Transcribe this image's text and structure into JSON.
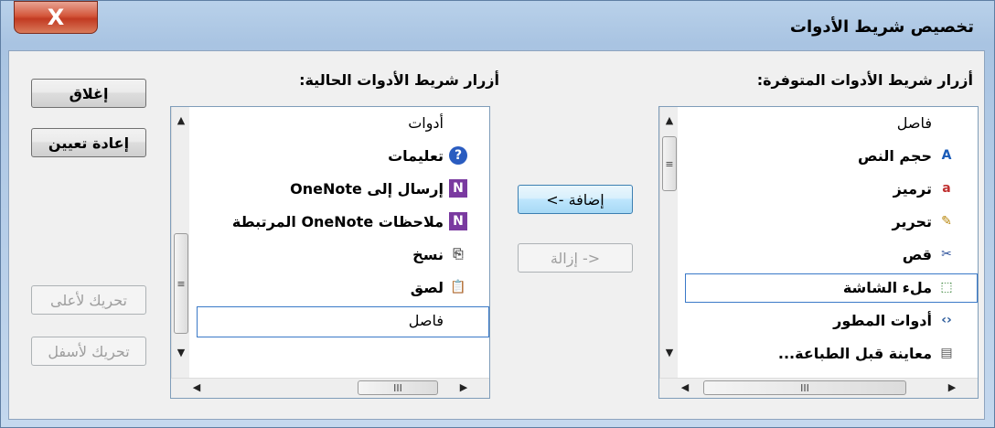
{
  "window": {
    "title": "تخصيص شريط الأدوات",
    "close_label": "X"
  },
  "available": {
    "label": "أزرار شريط الأدوات المتوفرة:",
    "items": [
      {
        "label": "فاصل",
        "icon": "none"
      },
      {
        "label": "حجم النص",
        "icon": "text-size-icon"
      },
      {
        "label": "ترميز",
        "icon": "encoding-icon"
      },
      {
        "label": "تحرير",
        "icon": "pencil-icon"
      },
      {
        "label": "قص",
        "icon": "scissors-icon"
      },
      {
        "label": "ملء الشاشة",
        "icon": "fullscreen-icon"
      },
      {
        "label": "أدوات المطور",
        "icon": "developer-tools-icon"
      },
      {
        "label": "معاينة قبل الطباعة...",
        "icon": "print-preview-icon"
      }
    ],
    "selected_index": 5
  },
  "current": {
    "label": "أزرار شريط الأدوات الحالية:",
    "items": [
      {
        "label": "أدوات",
        "icon": "none"
      },
      {
        "label": "تعليمات",
        "icon": "help-icon"
      },
      {
        "label": "إرسال إلى OneNote",
        "icon": "onenote-send-icon"
      },
      {
        "label": "ملاحظات OneNote المرتبطة",
        "icon": "onenote-linked-notes-icon"
      },
      {
        "label": "نسخ",
        "icon": "copy-icon"
      },
      {
        "label": "لصق",
        "icon": "paste-icon"
      },
      {
        "label": "فاصل",
        "icon": "none"
      }
    ],
    "selected_index": 6
  },
  "buttons": {
    "add": "إضافة ->",
    "remove": "<- إزالة",
    "close": "إغلاق",
    "reset": "إعادة تعيين",
    "move_up": "تحريك لأعلى",
    "move_down": "تحريك لأسفل"
  },
  "scroll": {
    "thumb_grip": "III",
    "vthumb_grip": "≡"
  }
}
